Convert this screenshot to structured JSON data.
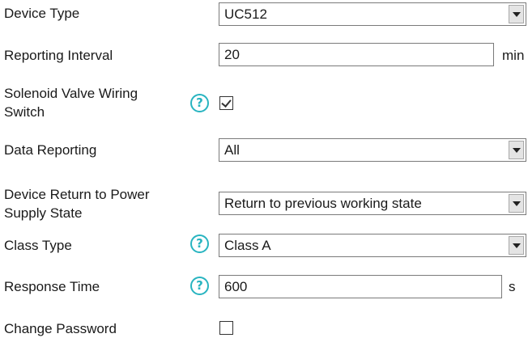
{
  "form": {
    "device_type": {
      "label": "Device Type",
      "value": "UC512"
    },
    "reporting_interval": {
      "label": "Reporting Interval",
      "value": "20",
      "unit": "min"
    },
    "solenoid_valve_wiring_switch": {
      "label_line1": "Solenoid Valve Wiring",
      "label_line2": "Switch",
      "checked": true
    },
    "data_reporting": {
      "label": "Data Reporting",
      "value": "All"
    },
    "device_return_to_power": {
      "label_line1": "Device Return to Power",
      "label_line2": "Supply State",
      "value": "Return to previous working state"
    },
    "class_type": {
      "label": "Class Type",
      "value": "Class A"
    },
    "response_time": {
      "label": "Response Time",
      "value": "600",
      "unit": "s"
    },
    "change_password": {
      "label": "Change Password",
      "checked": false
    }
  },
  "help_icon_glyph": "?",
  "colors": {
    "help_icon": "#28b4c0",
    "border": "#7a7a7a",
    "dropdown_button": "#e4e4e4"
  }
}
